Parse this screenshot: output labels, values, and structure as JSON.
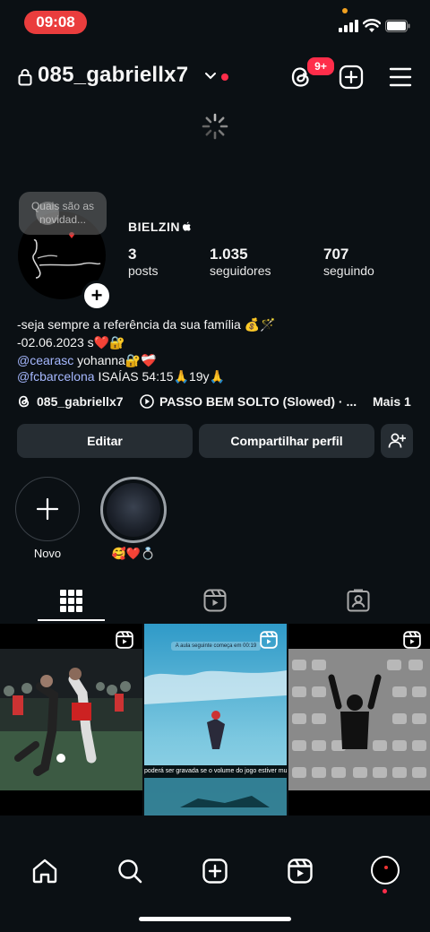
{
  "status_bar": {
    "time": "09:08"
  },
  "header": {
    "username": "085_gabriellx7",
    "notification_badge": "9+"
  },
  "note": {
    "placeholder": "Quais são as novidad..."
  },
  "profile": {
    "display_name": "BIELZIN",
    "stats": [
      {
        "value": "3",
        "label": "posts"
      },
      {
        "value": "1.035",
        "label": "seguidores"
      },
      {
        "value": "707",
        "label": "seguindo"
      }
    ],
    "bio": {
      "line1": "-seja sempre a referência da sua família 💰🪄",
      "line2": "-02.06.2023 s❤️🔐",
      "line3_mention": "@cearasc",
      "line3_rest": " yohanna🔐❤️‍🩹",
      "line4_mention": "@fcbarcelona",
      "line4_rest": " ISAÍAS 54:15🙏19y🙏"
    },
    "threads_handle": "085_gabriellx7",
    "music": "PASSO BEM SOLTO (Slowed) · ...",
    "more": "Mais 1"
  },
  "actions": {
    "edit": "Editar",
    "share": "Compartilhar perfil"
  },
  "highlights": [
    {
      "label": "Novo"
    },
    {
      "label": "🥰❤️💍"
    }
  ],
  "grid": {
    "post2_top_text": "A aula seguinte começa em 00:19",
    "post2_caption": "poderá ser gravada se o volume do jogo estiver muit"
  },
  "colors": {
    "accent_red": "#ff2d4a",
    "mention": "#a6b8ff",
    "background": "#0b1014"
  }
}
